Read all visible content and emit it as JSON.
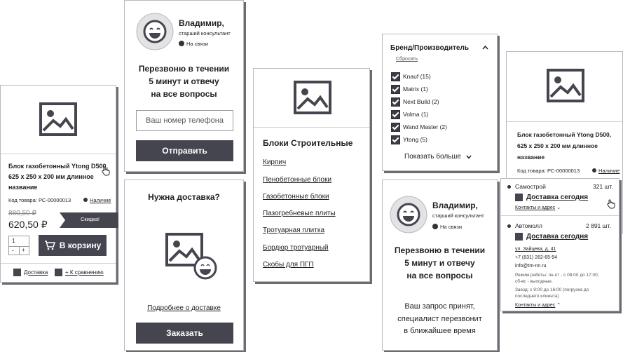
{
  "product_card": {
    "title_l1": "Блок газобетонный Ytong D500,",
    "title_l2": "625 х 250 х 200 мм длинное",
    "title_l3": "название",
    "code": "Код товара: РС-00000013",
    "availability": "Наличие",
    "old_price": "880,50 ₽",
    "price": "620,50 ₽",
    "discount": "Скидка!",
    "qty": "1",
    "minus": "-",
    "plus": "+",
    "cart_button": "В корзину",
    "delivery": "Доставка",
    "compare": "+ К сравнению"
  },
  "callback_card": {
    "name": "Владимир,",
    "role": "старший консультант",
    "status": "На связи",
    "headline_l1": "Перезвоню в течении",
    "headline_l2": "5 минут и отвечу",
    "headline_l3": "на все вопросы",
    "phone_placeholder": "Ваш номер телефона",
    "submit": "Отправить"
  },
  "delivery_card": {
    "title": "Нужна доставка?",
    "more_link": "Подробнее о доставке",
    "order_button": "Заказать"
  },
  "category_card": {
    "title": "Блоки Строительные",
    "items": [
      "Кирпич",
      "Пенобетонные блоки",
      "Газобетонные блоки",
      "Пазогребневые плиты",
      "Тротуарная плитка",
      "Бордюр тротуарный",
      "Скобы для ПГП"
    ]
  },
  "brand_filter": {
    "title": "Бренд/Производитель",
    "reset": "Сбросить",
    "brands": [
      "Knauf (15)",
      "Matrix (1)",
      "Next Build (2)",
      "Volma (1)",
      "Wand Master (2)",
      "Ytong (5)"
    ],
    "show_more": "Показать больше"
  },
  "callback_success": {
    "name": "Владимир,",
    "role": "старший консультант",
    "status": "На связи",
    "headline_l1": "Перезвоню в течении",
    "headline_l2": "5 минут и отвечу",
    "headline_l3": "на все вопросы",
    "msg_l1": "Ваш запрос принят,",
    "msg_l2": "специалист перезвонит",
    "msg_l3": "в ближайшее время"
  },
  "stock_card": {
    "title_l1": "Блок газобетонный Ytong D500,",
    "title_l2": "625 х 250 х 200 мм длинное",
    "title_l3": "название",
    "code": "Код товара: РС-00000013",
    "availability": "Наличие",
    "store1_name": "Самострой",
    "store1_qty": "321 шт.",
    "store1_delivery": "Доставка сегодня",
    "store1_contacts": "Контакты и адрес",
    "store2_name": "Автомолл",
    "store2_qty": "2 891 шт.",
    "store2_delivery": "Доставка сегодня",
    "address": "ул. Зайцева, д. 41",
    "phone": "+7 (831) 262-65-94",
    "email": "info@tm-nn.ru",
    "hours_l1": "Режим работы: пн-пт - с 08:00 до 17:00;",
    "hours_l2": "сб-вс - выходные.",
    "pickup_l1": "Заезд: с 9:00 до 16:00 (погрузка до",
    "pickup_l2": "последнего клиента)",
    "store2_contacts": "Контакты и адрес"
  },
  "colors": {
    "dark": "#45454f",
    "border": "#b9b9be",
    "shadow": "#6b6b72"
  },
  "icons": [
    "image-placeholder-icon",
    "smiley-avatar-icon",
    "hand-cursor-icon",
    "cart-icon",
    "chevron-up-icon",
    "chevron-down-icon",
    "checkbox-checked-icon"
  ]
}
